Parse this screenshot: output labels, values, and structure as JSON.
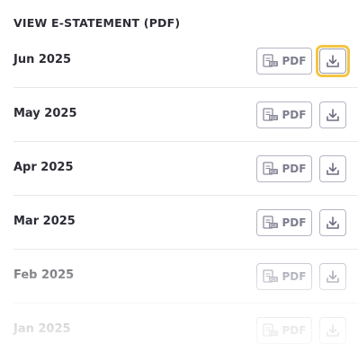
{
  "section": {
    "title": "VIEW E-STATEMENT (PDF)"
  },
  "statements": [
    {
      "month": "Jun 2025",
      "pdf_label": "PDF"
    },
    {
      "month": "May 2025",
      "pdf_label": "PDF"
    },
    {
      "month": "Apr 2025",
      "pdf_label": "PDF"
    },
    {
      "month": "Mar 2025",
      "pdf_label": "PDF"
    },
    {
      "month": "Feb 2025",
      "pdf_label": "PDF"
    },
    {
      "month": "Jan 2025",
      "pdf_label": "PDF"
    }
  ],
  "icons": {
    "pdf": "document-icon",
    "download": "download-icon"
  },
  "colors": {
    "highlight": "#f4c542",
    "border": "#b5b5c4",
    "text": "#2c2c36"
  }
}
